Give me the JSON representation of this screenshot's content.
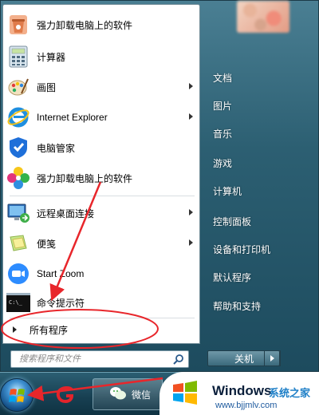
{
  "left_pane": {
    "programs": [
      {
        "label": "强力卸载电脑上的软件",
        "icon": "uninstall-icon",
        "submenu": false
      },
      {
        "label": "计算器",
        "icon": "calculator-icon",
        "submenu": false
      },
      {
        "label": "画图",
        "icon": "paint-icon",
        "submenu": true
      },
      {
        "label": "Internet Explorer",
        "icon": "internet-explorer-icon",
        "submenu": true
      },
      {
        "label": "电脑管家",
        "icon": "pc-manager-icon",
        "submenu": false
      },
      {
        "label": "强力卸载电脑上的软件",
        "icon": "colorful-flower-icon",
        "submenu": false
      },
      {
        "label": "远程桌面连接",
        "icon": "remote-desktop-icon",
        "submenu": true
      },
      {
        "label": "便笺",
        "icon": "sticky-notes-icon",
        "submenu": true
      },
      {
        "label": "Start Zoom",
        "icon": "zoom-icon",
        "submenu": false
      },
      {
        "label": "命令提示符",
        "icon": "cmd-icon",
        "submenu": false
      }
    ],
    "all_programs_label": "所有程序",
    "search_placeholder": "搜索程序和文件"
  },
  "right_pane": {
    "items": [
      "文档",
      "图片",
      "音乐",
      "游戏",
      "计算机",
      "控制面板",
      "设备和打印机",
      "默认程序",
      "帮助和支持"
    ],
    "shutdown_label": "关机"
  },
  "taskbar": {
    "wechat_label": "微信"
  },
  "watermark": {
    "brand": "Windows",
    "cn": "系统之家",
    "url": "www.bjjmlv.com"
  },
  "colors": {
    "annotation_red": "#e8262b",
    "menu_right_bg": "#2c5f72",
    "watermark_blue": "#1e7fc7"
  }
}
